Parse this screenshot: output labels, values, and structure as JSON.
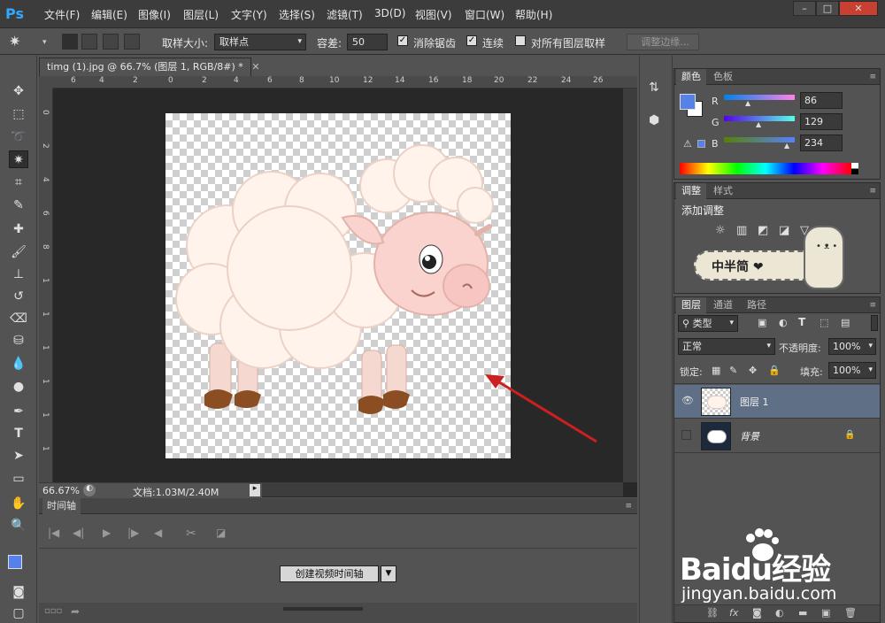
{
  "app": {
    "logo": "Ps"
  },
  "menu": [
    "文件(F)",
    "编辑(E)",
    "图像(I)",
    "图层(L)",
    "文字(Y)",
    "选择(S)",
    "滤镜(T)",
    "3D(D)",
    "视图(V)",
    "窗口(W)",
    "帮助(H)"
  ],
  "window_controls": [
    "minimize-icon",
    "maximize-icon",
    "close-icon"
  ],
  "options": {
    "sample_size_label": "取样大小:",
    "sample_size_value": "取样点",
    "tolerance_label": "容差:",
    "tolerance_value": "50",
    "antialias_label": "消除锯齿",
    "contiguous_label": "连续",
    "all_layers_label": "对所有图层取样",
    "refine_edge_label": "调整边缘..."
  },
  "document": {
    "tab_title": "timg (1).jpg @ 66.7% (图层 1, RGB/8#) *",
    "ruler_ticks": [
      "6",
      "4",
      "2",
      "0",
      "2",
      "4",
      "6",
      "8",
      "10",
      "12",
      "14",
      "16",
      "18",
      "20",
      "22",
      "24",
      "26"
    ],
    "vruler_ticks": [
      "0",
      "2",
      "4",
      "6",
      "8",
      "1",
      "1",
      "1",
      "1",
      "1",
      "1"
    ],
    "zoom": "66.67%",
    "doc_info": "文档:1.03M/2.40M"
  },
  "timeline": {
    "tab_label": "时间轴",
    "create_button": "创建视频时间轴"
  },
  "color_panel": {
    "tabs": [
      "颜色",
      "色板"
    ],
    "r_label": "R",
    "r_value": "86",
    "g_label": "G",
    "g_value": "129",
    "b_label": "B",
    "b_value": "234",
    "foreground_color": "#5681ea"
  },
  "adjust_panel": {
    "tabs": [
      "调整",
      "样式"
    ],
    "add_adjustment": "添加调整",
    "sticker_text": "中半简 ❤"
  },
  "layers_panel": {
    "tabs": [
      "图层",
      "通道",
      "路径"
    ],
    "kind_filter": "类型",
    "blend_mode": "正常",
    "opacity_label": "不透明度:",
    "opacity_value": "100%",
    "lock_label": "锁定:",
    "fill_label": "填充:",
    "fill_value": "100%",
    "layers": [
      {
        "name": "图层 1",
        "selected": true,
        "visible": true
      },
      {
        "name": "背景",
        "selected": false,
        "visible": false,
        "locked": true
      }
    ]
  },
  "watermark": {
    "brand": "Baidu经验",
    "url": "jingyan.baidu.com"
  },
  "colors": {
    "accent": "#31a8ff",
    "selection": "#5e6f86",
    "arrow": "#cc1f1f"
  }
}
